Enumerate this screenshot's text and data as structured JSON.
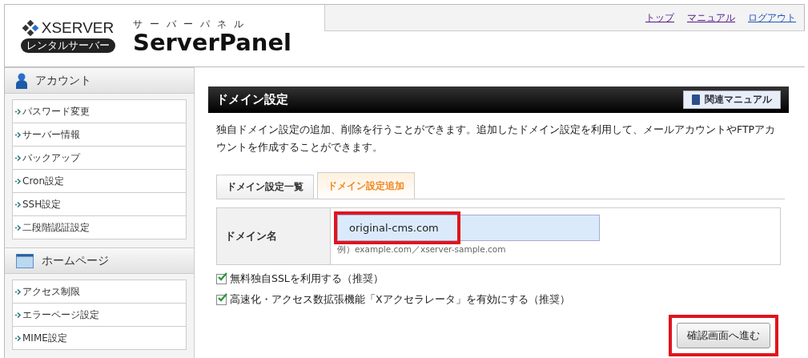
{
  "header": {
    "logo": {
      "brand": "XSERVER",
      "badge": "レンタルサーバー",
      "kana": "サーバーパネル",
      "product": "ServerPanel"
    },
    "links": [
      {
        "label": "トップ"
      },
      {
        "label": "マニュアル"
      },
      {
        "label": "ログアウト"
      }
    ]
  },
  "sidebar": {
    "sections": [
      {
        "kind": "account",
        "title": "アカウント",
        "items": [
          "パスワード変更",
          "サーバー情報",
          "バックアップ",
          "Cron設定",
          "SSH設定",
          "二段階認証設定"
        ]
      },
      {
        "kind": "homepage",
        "title": "ホームページ",
        "items": [
          "アクセス制限",
          "エラーページ設定",
          "MIME設定"
        ]
      }
    ]
  },
  "main": {
    "title": "ドメイン設定",
    "manual_button": "関連マニュアル",
    "description": "独自ドメイン設定の追加、削除を行うことができます。追加したドメイン設定を利用して、メールアカウントやFTPアカウントを作成することができます。",
    "tabs": [
      {
        "label": "ドメイン設定一覧",
        "selected": false
      },
      {
        "label": "ドメイン設定追加",
        "selected": true
      }
    ],
    "form": {
      "label": "ドメイン名",
      "value": "original-cms.com",
      "hint": "例）example.com／xserver-sample.com",
      "highlighted": true
    },
    "options": [
      {
        "label": "無料独自SSLを利用する（推奨）",
        "checked": true
      },
      {
        "label": "高速化・アクセス数拡張機能「Xアクセラレータ」を有効にする（推奨）",
        "checked": true
      }
    ],
    "submit": {
      "label": "確認画面へ進む",
      "highlighted": true
    }
  }
}
